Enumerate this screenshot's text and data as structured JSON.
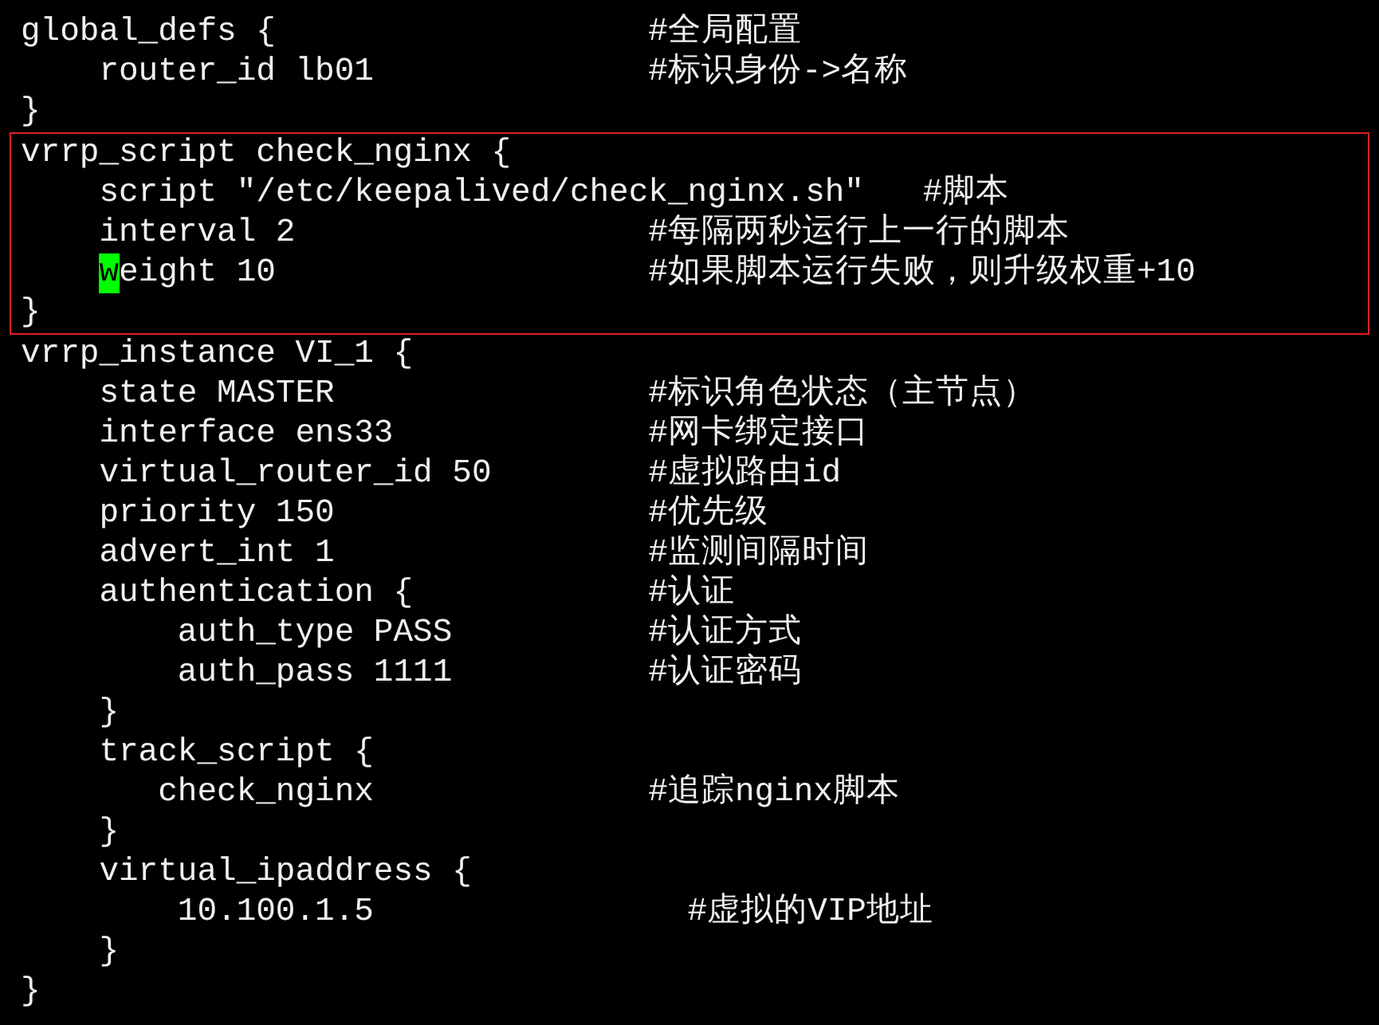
{
  "lines_before": [
    {
      "text": "global_defs {                   #全局配置"
    },
    {
      "text": "    router_id lb01              #标识身份->名称"
    },
    {
      "text": "}"
    }
  ],
  "boxed_block": {
    "lines": [
      {
        "text": "vrrp_script check_nginx {"
      },
      {
        "text": "    script \"/etc/keepalived/check_nginx.sh\"   #脚本"
      },
      {
        "text": "    interval 2                  #每隔两秒运行上一行的脚本"
      },
      {
        "cursor": "w",
        "text_after": "eight 10                   #如果脚本运行失败，则升级权重+10"
      },
      {
        "text": "}"
      }
    ]
  },
  "lines_after": [
    {
      "text": "vrrp_instance VI_1 {"
    },
    {
      "text": "    state MASTER                #标识角色状态（主节点）"
    },
    {
      "text": "    interface ens33             #网卡绑定接口"
    },
    {
      "text": "    virtual_router_id 50        #虚拟路由id"
    },
    {
      "text": "    priority 150                #优先级"
    },
    {
      "text": "    advert_int 1                #监测间隔时间"
    },
    {
      "text": "    authentication {            #认证"
    },
    {
      "text": "        auth_type PASS          #认证方式"
    },
    {
      "text": "        auth_pass 1111          #认证密码"
    },
    {
      "text": "    }"
    },
    {
      "text": "    track_script {"
    },
    {
      "text": "       check_nginx              #追踪nginx脚本"
    },
    {
      "text": "    }"
    },
    {
      "text": "    virtual_ipaddress {"
    },
    {
      "text": "        10.100.1.5                #虚拟的VIP地址"
    },
    {
      "text": "    }"
    },
    {
      "text": "}"
    }
  ]
}
